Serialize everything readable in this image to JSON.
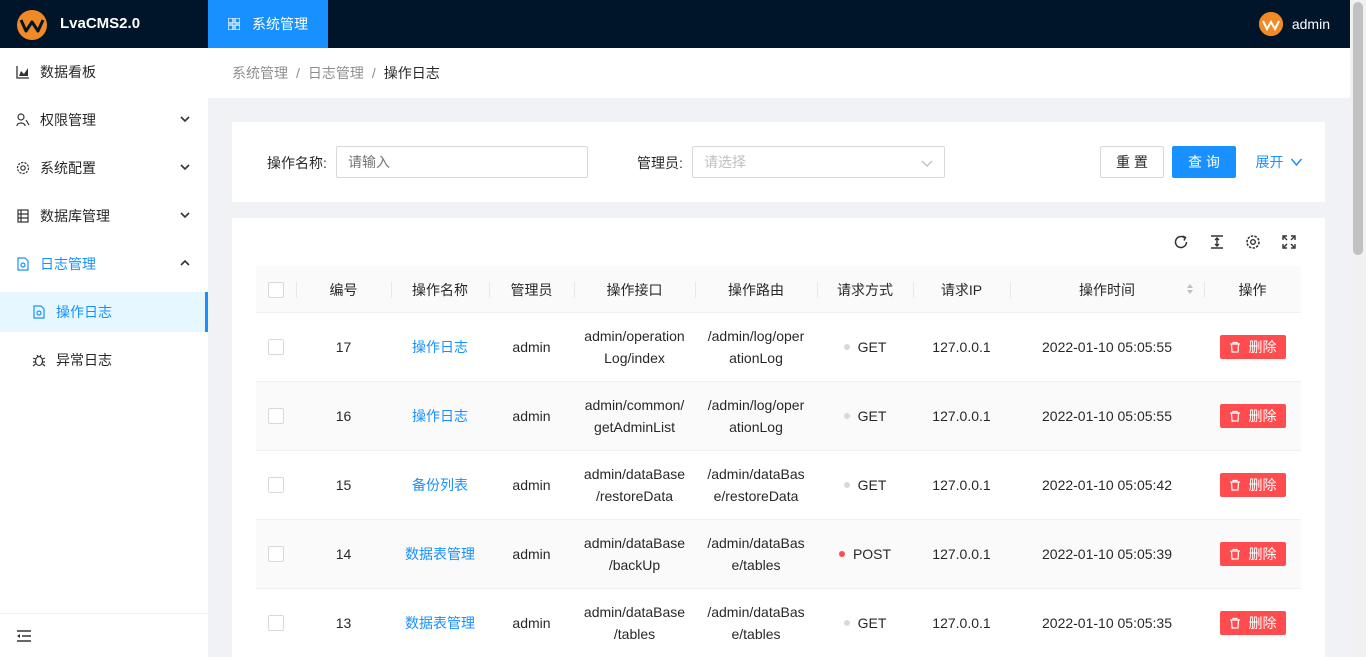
{
  "app": {
    "brand": "LvaCMS2.0"
  },
  "top_menu": {
    "label": "系统管理"
  },
  "user": {
    "name": "admin"
  },
  "sidebar": {
    "items": [
      {
        "label": "数据看板"
      },
      {
        "label": "权限管理"
      },
      {
        "label": "系统配置"
      },
      {
        "label": "数据库管理"
      },
      {
        "label": "日志管理"
      },
      {
        "label": "操作日志"
      },
      {
        "label": "异常日志"
      }
    ]
  },
  "breadcrumb": {
    "items": [
      "系统管理",
      "日志管理",
      "操作日志"
    ],
    "sep": "/"
  },
  "filter": {
    "name_label": "操作名称:",
    "name_placeholder": "请输入",
    "admin_label": "管理员:",
    "admin_placeholder": "请选择",
    "reset": "重 置",
    "query": "查 询",
    "expand": "展开"
  },
  "table": {
    "columns": [
      "编号",
      "操作名称",
      "管理员",
      "操作接口",
      "操作路由",
      "请求方式",
      "请求IP",
      "操作时间",
      "操作"
    ],
    "delete_label": "删除",
    "rows": [
      {
        "id": "17",
        "name": "操作日志",
        "admin": "admin",
        "api1": "admin/operation",
        "api2": "Log/index",
        "route1": "/admin/log/oper",
        "route2": "ationLog",
        "method": "GET",
        "ip": "127.0.0.1",
        "time": "2022-01-10 05:05:55"
      },
      {
        "id": "16",
        "name": "操作日志",
        "admin": "admin",
        "api1": "admin/common/",
        "api2": "getAdminList",
        "route1": "/admin/log/oper",
        "route2": "ationLog",
        "method": "GET",
        "ip": "127.0.0.1",
        "time": "2022-01-10 05:05:55"
      },
      {
        "id": "15",
        "name": "备份列表",
        "admin": "admin",
        "api1": "admin/dataBase",
        "api2": "/restoreData",
        "route1": "/admin/dataBas",
        "route2": "e/restoreData",
        "method": "GET",
        "ip": "127.0.0.1",
        "time": "2022-01-10 05:05:42"
      },
      {
        "id": "14",
        "name": "数据表管理",
        "admin": "admin",
        "api1": "admin/dataBase",
        "api2": "/backUp",
        "route1": "/admin/dataBas",
        "route2": "e/tables",
        "method": "POST",
        "ip": "127.0.0.1",
        "time": "2022-01-10 05:05:39"
      },
      {
        "id": "13",
        "name": "数据表管理",
        "admin": "admin",
        "api1": "admin/dataBase",
        "api2": "/tables",
        "route1": "/admin/dataBas",
        "route2": "e/tables",
        "method": "GET",
        "ip": "127.0.0.1",
        "time": "2022-01-10 05:05:35"
      }
    ]
  },
  "colors": {
    "primary": "#1890ff",
    "danger": "#ff4d4f",
    "header": "#001529",
    "get_dot": "#d9d9d9",
    "post_dot": "#ff4d4f"
  }
}
